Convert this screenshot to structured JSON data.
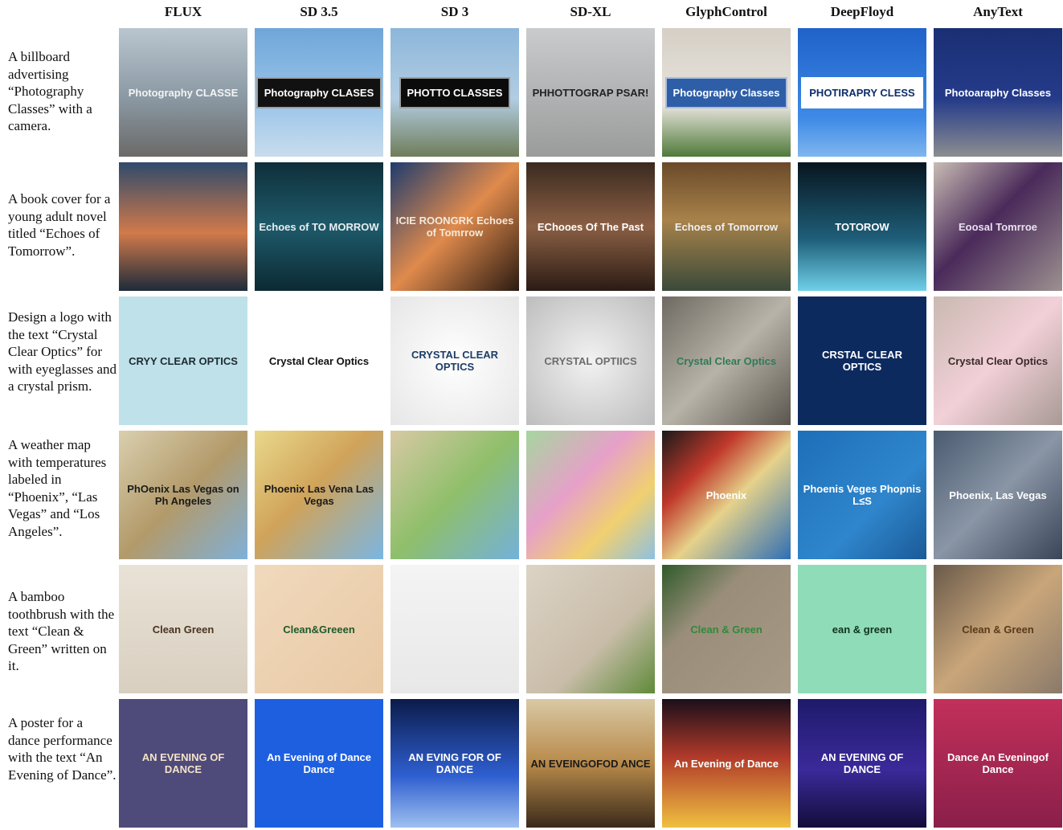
{
  "models": [
    "FLUX",
    "SD 3.5",
    "SD 3",
    "SD-XL",
    "GlyphControl",
    "DeepFloyd",
    "AnyText"
  ],
  "rows": [
    {
      "prompt": "A billboard advertising “Photography Classes” with a camera.",
      "cells": [
        {
          "text": "Photography CLASSE",
          "bg": "linear-gradient(180deg,#b9c6cf 0%,#8a98a3 55%,#6b6a68 100%)",
          "fg": "#f4f4f4"
        },
        {
          "text": "Photography CLASES",
          "bg": "linear-gradient(180deg,#6fa6d9 0%,#9cc6ea 60%,#c9dcec 100%)",
          "fg": "#ffffff",
          "panel": "#111"
        },
        {
          "text": "PHOTTO CLASSES",
          "bg": "linear-gradient(180deg,#8cb6da 0%,#b2cde3 55%,#6f7d5a 100%)",
          "fg": "#ffffff",
          "panel": "#0b0b0b"
        },
        {
          "text": "PHHOTTOGRAP PSAR!",
          "bg": "linear-gradient(180deg,#c9cbcc 0%,#9a9c9c 100%)",
          "fg": "#222"
        },
        {
          "text": "Photography Classes",
          "bg": "linear-gradient(180deg,#d5cfc6 0%,#e8e4dd 60%,#4f7a3a 100%)",
          "fg": "#ffffff",
          "panel": "#2f5ea8"
        },
        {
          "text": "PHOTIRAPRY CLESS",
          "bg": "linear-gradient(180deg,#1f62c9 0%,#3f8ae6 70%,#7fb6ef 100%)",
          "fg": "#0d2d6b",
          "panel": "#ffffff"
        },
        {
          "text": "Photoaraphy Classes",
          "bg": "linear-gradient(180deg,#1a2f73 0%,#253b8a 55%,#8c8e90 100%)",
          "fg": "#ffffff"
        }
      ]
    },
    {
      "prompt": "A book cover for a young adult novel titled “Echoes of Tomorrow”.",
      "cells": [
        {
          "text": "",
          "bg": "linear-gradient(180deg,#2f4a6b 0%,#d17a4a 55%,#1d2b3a 100%)",
          "fg": "#fff"
        },
        {
          "text": "Echoes of TO MORROW",
          "bg": "linear-gradient(180deg,#0f2f3a 0%,#1e5a6a 50%,#0c2a33 100%)",
          "fg": "#e8eef0"
        },
        {
          "text": "ICIE ROONGRK Echoes of Tomrrow",
          "bg": "linear-gradient(135deg,#1f3c6e 0%,#e08a4c 50%,#2a1b12 100%)",
          "fg": "#f3e9d9"
        },
        {
          "text": "EChooes Of The Past",
          "bg": "linear-gradient(180deg,#3b2a20 0%,#8a5f44 50%,#2b1b14 100%)",
          "fg": "#ffffff"
        },
        {
          "text": "Echoes of Tomorrow",
          "bg": "linear-gradient(180deg,#6a4a2a 0%,#a8824a 45%,#3a4a3a 100%)",
          "fg": "#f0f0f0"
        },
        {
          "text": "TOTOROW",
          "bg": "linear-gradient(180deg,#07151f 0%,#1f5f7a 60%,#6fd0e8 100%)",
          "fg": "#ffffff"
        },
        {
          "text": "Eoosal Tomrroe",
          "bg": "linear-gradient(135deg,#c8bcb4 0%,#4a2a5a 45%,#9c9190 100%)",
          "fg": "#e9e0f0"
        }
      ]
    },
    {
      "prompt": "Design a logo with the text “Crystal Clear Optics” for with eyeglasses and a crystal prism.",
      "cells": [
        {
          "text": "CRYY CLEAR OPTICS",
          "bg": "#bfe1e9",
          "fg": "#1e2a33"
        },
        {
          "text": "Crystal Clear Optics",
          "bg": "#ffffff",
          "fg": "#111111"
        },
        {
          "text": "CRYSTAL CLEAR OPTICS",
          "bg": "radial-gradient(circle,#ffffff 0%,#e6e6e6 100%)",
          "fg": "#1d3c66"
        },
        {
          "text": "CRYSTAL OPTIICS",
          "bg": "radial-gradient(circle,#f2f2f2 0%,#bdbdbd 100%)",
          "fg": "#6d6d6d"
        },
        {
          "text": "Crystal Clear Optics",
          "bg": "linear-gradient(135deg,#6e6a62 0%,#b8b3a8 50%,#5a564e 100%)",
          "fg": "#2f7a5a"
        },
        {
          "text": "CRSTAL CLEAR OPTICS",
          "bg": "#0d2a5f",
          "fg": "#ffffff"
        },
        {
          "text": "Crystal Clear Optics",
          "bg": "linear-gradient(135deg,#c9b9b1 0%,#f2d0d8 50%,#a89a94 100%)",
          "fg": "#3a2a2a"
        }
      ]
    },
    {
      "prompt": "A weather map with temperatures labeled in “Phoenix”, “Las Vegas” and “Los Angeles”.",
      "cells": [
        {
          "text": "PhOenix Las Vegas on Ph Angeles",
          "bg": "linear-gradient(135deg,#d9cfae 0%,#b39a6a 50%,#7fb0d9 100%)",
          "fg": "#1a1a1a"
        },
        {
          "text": "Phoenix Las Vena Las Vegas",
          "bg": "linear-gradient(135deg,#e9d88a 0%,#d0a35a 45%,#7bb6e2 100%)",
          "fg": "#1a1a1a"
        },
        {
          "text": "",
          "bg": "linear-gradient(135deg,#d8c9a5 0%,#8fbf6a 50%,#74b1da 100%)",
          "fg": "#1a1a1a"
        },
        {
          "text": "",
          "bg": "linear-gradient(135deg,#a6d6a0 0%,#e6a0c8 40%,#f0d070 70%,#8fc0e0 100%)",
          "fg": "#1a1a1a"
        },
        {
          "text": "Phoenix",
          "bg": "linear-gradient(135deg,#1a1a1a 0%,#c0392b 30%,#e6d28a 55%,#2f6fb5 100%)",
          "fg": "#ffffff"
        },
        {
          "text": "Phoenis Veges Phopnis L≤S",
          "bg": "linear-gradient(135deg,#1d6fb8 0%,#2f86cc 60%,#1b5a98 100%)",
          "fg": "#ffffff"
        },
        {
          "text": "Phoenix, Las Vegas",
          "bg": "linear-gradient(135deg,#4a5a70 0%,#8a96a6 50%,#3a4558 100%)",
          "fg": "#ffffff"
        }
      ]
    },
    {
      "prompt": "A bamboo toothbrush with the text “Clean & Green” written on it.",
      "cells": [
        {
          "text": "Clean Green",
          "bg": "linear-gradient(180deg,#e9e2d6 0%,#d8cfc0 100%)",
          "fg": "#4a3420"
        },
        {
          "text": "Clean&Greeen",
          "bg": "linear-gradient(135deg,#f1d9bd 0%,#e8c9a4 100%)",
          "fg": "#1f5a2a"
        },
        {
          "text": "",
          "bg": "linear-gradient(180deg,#f4f4f4 0%,#e8e8e8 100%)",
          "fg": "#3a2a1a"
        },
        {
          "text": "",
          "bg": "linear-gradient(135deg,#dcd3c6 0%,#c9bda9 60%,#5f8a3a 100%)",
          "fg": "#3a2a1a"
        },
        {
          "text": "Clean & Green",
          "bg": "linear-gradient(135deg,#2f5a2a 0%,#9a8e7a 35%,#a69a86 100%)",
          "fg": "#2f8a3a"
        },
        {
          "text": "ean & green",
          "bg": "#8fdcb8",
          "fg": "#11331f"
        },
        {
          "text": "Clean & Green",
          "bg": "linear-gradient(135deg,#6a5a4a 0%,#c9a67a 50%,#8a7a6a 100%)",
          "fg": "#5a3a1a"
        }
      ]
    },
    {
      "prompt": "A poster for a dance performance with the text “An Evening of Dance”.",
      "cells": [
        {
          "text": "AN EVENING OF DANCE",
          "bg": "#4e4a79",
          "fg": "#f5e3c8"
        },
        {
          "text": "An Evening of Dance Dance",
          "bg": "#1e5fe0",
          "fg": "#ffffff"
        },
        {
          "text": "AN EVING FOR OF DANCE",
          "bg": "linear-gradient(180deg,#0b1b4a 0%,#2f5fd0 60%,#9fc0f0 100%)",
          "fg": "#ffffff"
        },
        {
          "text": "AN EVEINGOFOD ANCE",
          "bg": "linear-gradient(180deg,#d9c9a5 0%,#b88a4a 50%,#3a2a1a 100%)",
          "fg": "#1a1a1a"
        },
        {
          "text": "An Evening of Dance",
          "bg": "linear-gradient(180deg,#1a0f1a 0%,#b03a2a 45%,#f0c040 100%)",
          "fg": "#ffffff"
        },
        {
          "text": "AN EVENING OF DANCE",
          "bg": "linear-gradient(180deg,#1f1a6a 0%,#3a2a9a 55%,#120d3a 100%)",
          "fg": "#ffffff"
        },
        {
          "text": "Dance An Eveningof Dance",
          "bg": "linear-gradient(180deg,#c2305a 0%,#8a1f4a 100%)",
          "fg": "#ffffff"
        }
      ]
    }
  ]
}
